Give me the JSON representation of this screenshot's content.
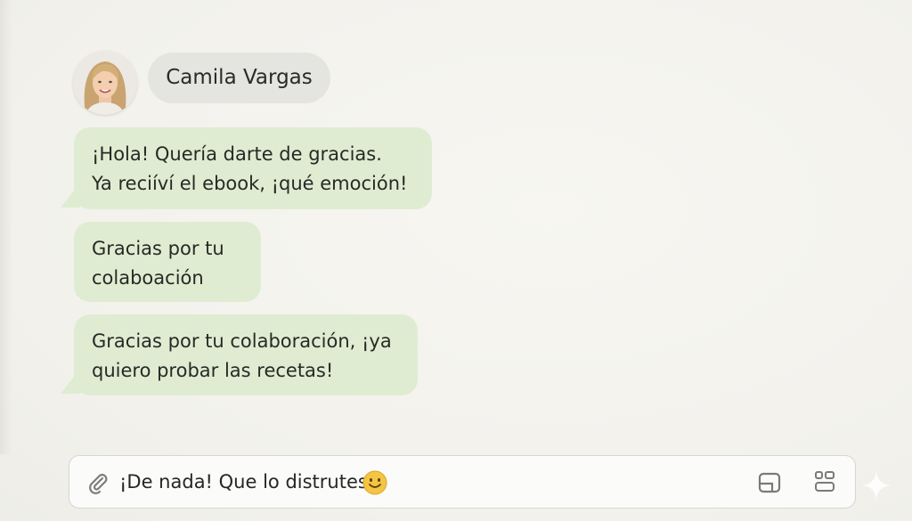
{
  "contact": {
    "name": "Camila Vargas"
  },
  "messages": [
    {
      "line1": "¡Hola! Quería darte de gracias.",
      "line2": "Ya reciíví el ebook, ¡qué emoción!"
    },
    {
      "line1": "Gracias por tu",
      "line2": "colaboación"
    },
    {
      "line1": "Gracias por tu colaboración, ¡ya",
      "line2": "quiero probar las recetas!"
    }
  ],
  "composer": {
    "text": "¡De nada! Que lo distrutes.",
    "emoji": "smiling-face"
  },
  "icons": {
    "attach": "paperclip-icon",
    "sticker": "sticker-icon",
    "apps": "apps-icon",
    "sparkle": "sparkle-icon"
  },
  "colors": {
    "bubble": "#dfecd2",
    "name_pill": "#e4e4e1",
    "background": "#f4f3ee",
    "emoji": "#f4c542"
  }
}
